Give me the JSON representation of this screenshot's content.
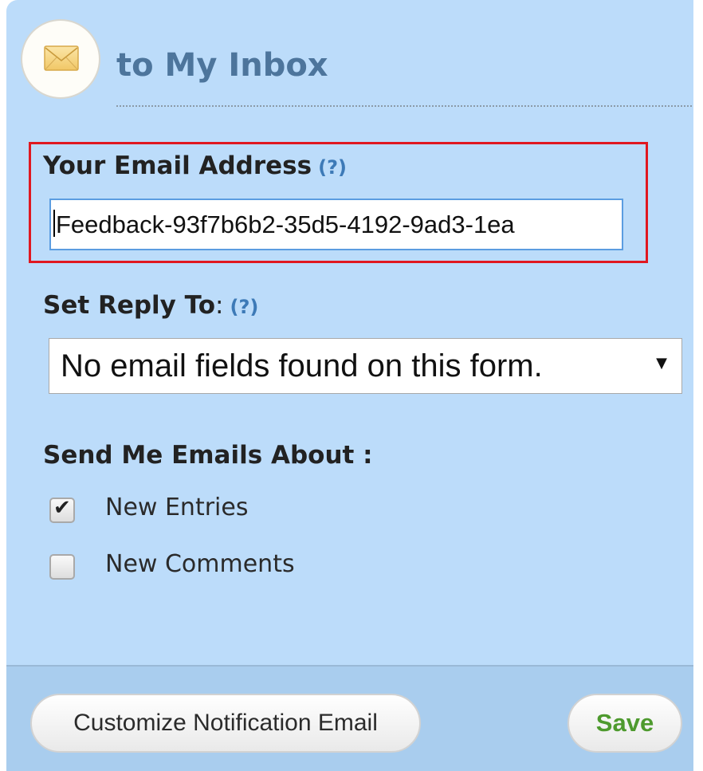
{
  "header": {
    "title": "to My Inbox",
    "icon": "envelope-icon"
  },
  "email_section": {
    "label": "Your Email Address",
    "help": "(?)",
    "value": "Feedback-93f7b6b2-35d5-4192-9ad3-1ea"
  },
  "reply_section": {
    "label": "Set Reply To",
    "colon": ":",
    "help": "(?)",
    "selected": "No email fields found on this form.",
    "arrow": "▼"
  },
  "send_section": {
    "label": "Send Me Emails About :",
    "options": [
      {
        "label": "New Entries",
        "checked": true,
        "mark": "✔"
      },
      {
        "label": "New Comments",
        "checked": false,
        "mark": ""
      }
    ]
  },
  "footer": {
    "customize_label": "Customize Notification Email",
    "save_label": "Save"
  },
  "colors": {
    "panel_bg": "#bcdcfa",
    "footer_bg": "#a9cdee",
    "title": "#4d759c",
    "help_link": "#3d7ab7",
    "highlight_border": "#e01820",
    "save_text": "#4e9a2e"
  }
}
